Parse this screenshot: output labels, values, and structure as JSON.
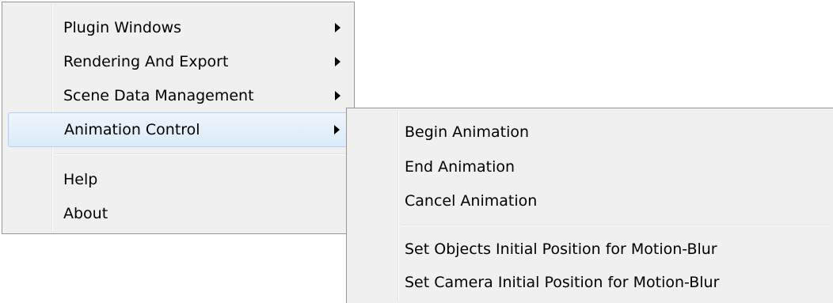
{
  "main_menu": {
    "items": [
      {
        "label": "Plugin Windows",
        "has_submenu": true
      },
      {
        "label": "Rendering And Export",
        "has_submenu": true
      },
      {
        "label": "Scene Data Management",
        "has_submenu": true
      },
      {
        "label": "Animation Control",
        "has_submenu": true,
        "highlighted": true
      },
      {
        "label": "Help",
        "has_submenu": false
      },
      {
        "label": "About",
        "has_submenu": false
      }
    ]
  },
  "sub_menu": {
    "items": [
      {
        "label": "Begin Animation"
      },
      {
        "label": "End Animation"
      },
      {
        "label": "Cancel Animation"
      },
      {
        "label": "Set Objects Initial Position for Motion-Blur"
      },
      {
        "label": "Set Camera Initial Position for Motion-Blur"
      }
    ]
  },
  "colors": {
    "menu_background": "#f0f0f0",
    "menu_border": "#979797",
    "highlight_top": "#eef5fc",
    "highlight_bottom": "#dbeaf9",
    "highlight_border": "#aecff7"
  }
}
